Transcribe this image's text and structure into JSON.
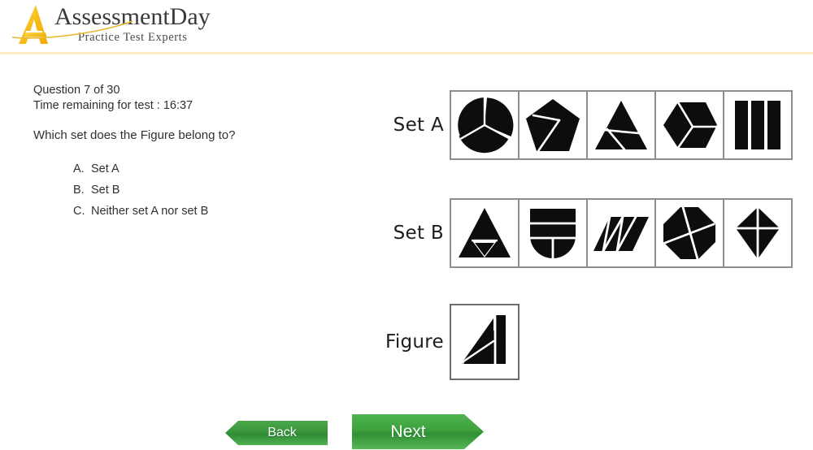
{
  "header": {
    "brand_main": "AssessmentDay",
    "brand_sub": "Practice Test Experts",
    "logo_icon": "assessmentday-a-logo-icon",
    "rule_color": "#fbeec0"
  },
  "question": {
    "counter": "Question 7 of 30",
    "timer": "Time remaining for test : 16:37",
    "prompt": "Which set does the Figure belong to?",
    "options": [
      {
        "letter": "A.",
        "text": "Set A"
      },
      {
        "letter": "B.",
        "text": "Set B"
      },
      {
        "letter": "C.",
        "text": "Neither set A nor set B"
      }
    ]
  },
  "sets": {
    "set_a_label": "Set A",
    "set_b_label": "Set B",
    "figure_label": "Figure",
    "set_a_shapes": [
      "circle-split-three",
      "pentagon-split-three",
      "triangle-split-three",
      "hexagon-split-three",
      "rectangle-split-three"
    ],
    "set_b_shapes": [
      "triangle-split-four",
      "shield-split-four",
      "parallelogram-split-four",
      "octagon-split-four",
      "kite-split-four"
    ],
    "figure_shape": "right-triangle-split-three",
    "shape_color": "#0d0d0d",
    "cell_border_color": "#8e8e8e"
  },
  "footer": {
    "back_label": "Back",
    "next_label": "Next",
    "button_color": "#3da23d"
  }
}
